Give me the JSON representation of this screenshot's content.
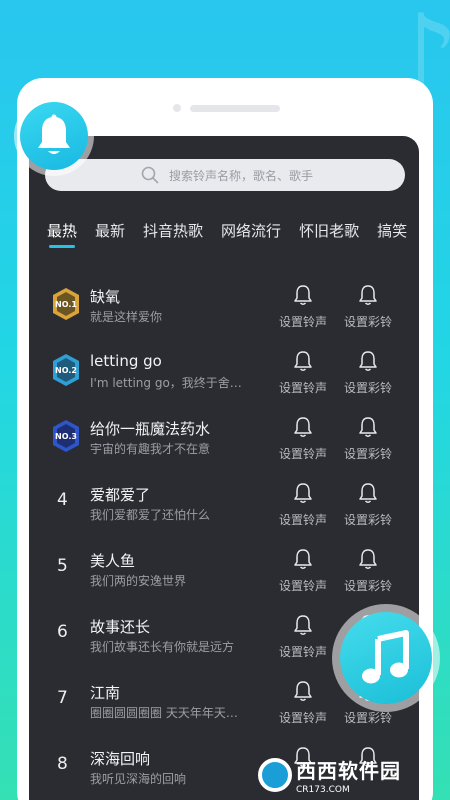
{
  "search": {
    "placeholder": "搜索铃声名称，歌名、歌手"
  },
  "tabs": [
    {
      "label": "最热",
      "active": true
    },
    {
      "label": "最新",
      "active": false
    },
    {
      "label": "抖音热歌",
      "active": false
    },
    {
      "label": "网络流行",
      "active": false
    },
    {
      "label": "怀旧老歌",
      "active": false
    },
    {
      "label": "搞笑",
      "active": false
    }
  ],
  "actions": {
    "ringtone": "设置铃声",
    "coloring": "设置彩铃"
  },
  "songs": [
    {
      "rank": "NO.1",
      "title": "缺氧",
      "subtitle": "就是这样爱你",
      "badge_color": "#d9a53a"
    },
    {
      "rank": "NO.2",
      "title": "letting go",
      "subtitle": "I'm letting go，我终于舍…",
      "badge_color": "#2f9fd6"
    },
    {
      "rank": "NO.3",
      "title": "给你一瓶魔法药水",
      "subtitle": "宇宙的有趣我才不在意",
      "badge_color": "#2f56c8"
    },
    {
      "rank": "4",
      "title": "爱都爱了",
      "subtitle": "我们爱都爱了还怕什么"
    },
    {
      "rank": "5",
      "title": "美人鱼",
      "subtitle": "我们两的安逸世界"
    },
    {
      "rank": "6",
      "title": "故事还长",
      "subtitle": "我们故事还长有你就是远方"
    },
    {
      "rank": "7",
      "title": "江南",
      "subtitle": "圈圈圆圆圈圈 天天年年天…"
    },
    {
      "rank": "8",
      "title": "深海回响",
      "subtitle": "我听见深海的回响"
    }
  ],
  "watermark": {
    "title": "西西软件园",
    "sub": "CR173.COM"
  },
  "colors": {
    "accent": "#23c4e6",
    "screen_bg": "#2b2c31"
  }
}
